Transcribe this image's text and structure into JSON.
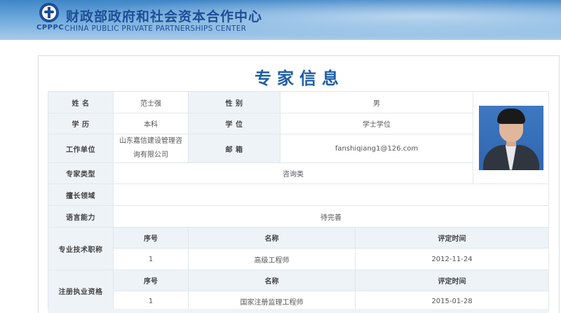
{
  "header": {
    "logo_abbr": "CPPPC",
    "cn_name": "财政部政府和社会资本合作中心",
    "en_name": "CHINA PUBLIC PRIVATE PARTNERSHIPS CENTER"
  },
  "page": {
    "title": "专家信息"
  },
  "expert": {
    "name_label": "姓 名",
    "name": "范士强",
    "gender_label": "性 别",
    "gender": "男",
    "education_label": "学 历",
    "education": "本科",
    "degree_label": "学 位",
    "degree": "学士学位",
    "employer_label": "工作单位",
    "employer": "山东嘉信建设管理咨询有限公司",
    "email_label": "邮 箱",
    "email": "fanshiqiang1@126.com",
    "type_label": "专家类型",
    "type": "咨询类",
    "expertise_label": "擅长领域",
    "expertise": "",
    "language_label": "语言能力",
    "language": "待完善"
  },
  "titles_section": {
    "label": "专业技术职称",
    "headers": [
      "序号",
      "名称",
      "评定时间"
    ],
    "rows": [
      {
        "no": "1",
        "name": "高级工程师",
        "date": "2012-11-24"
      }
    ]
  },
  "qualifications_section": {
    "label": "注册执业资格",
    "headers": [
      "序号",
      "名称",
      "评定时间"
    ],
    "rows": [
      {
        "no": "1",
        "name": "国家注册监理工程师",
        "date": "2015-01-28"
      }
    ]
  }
}
